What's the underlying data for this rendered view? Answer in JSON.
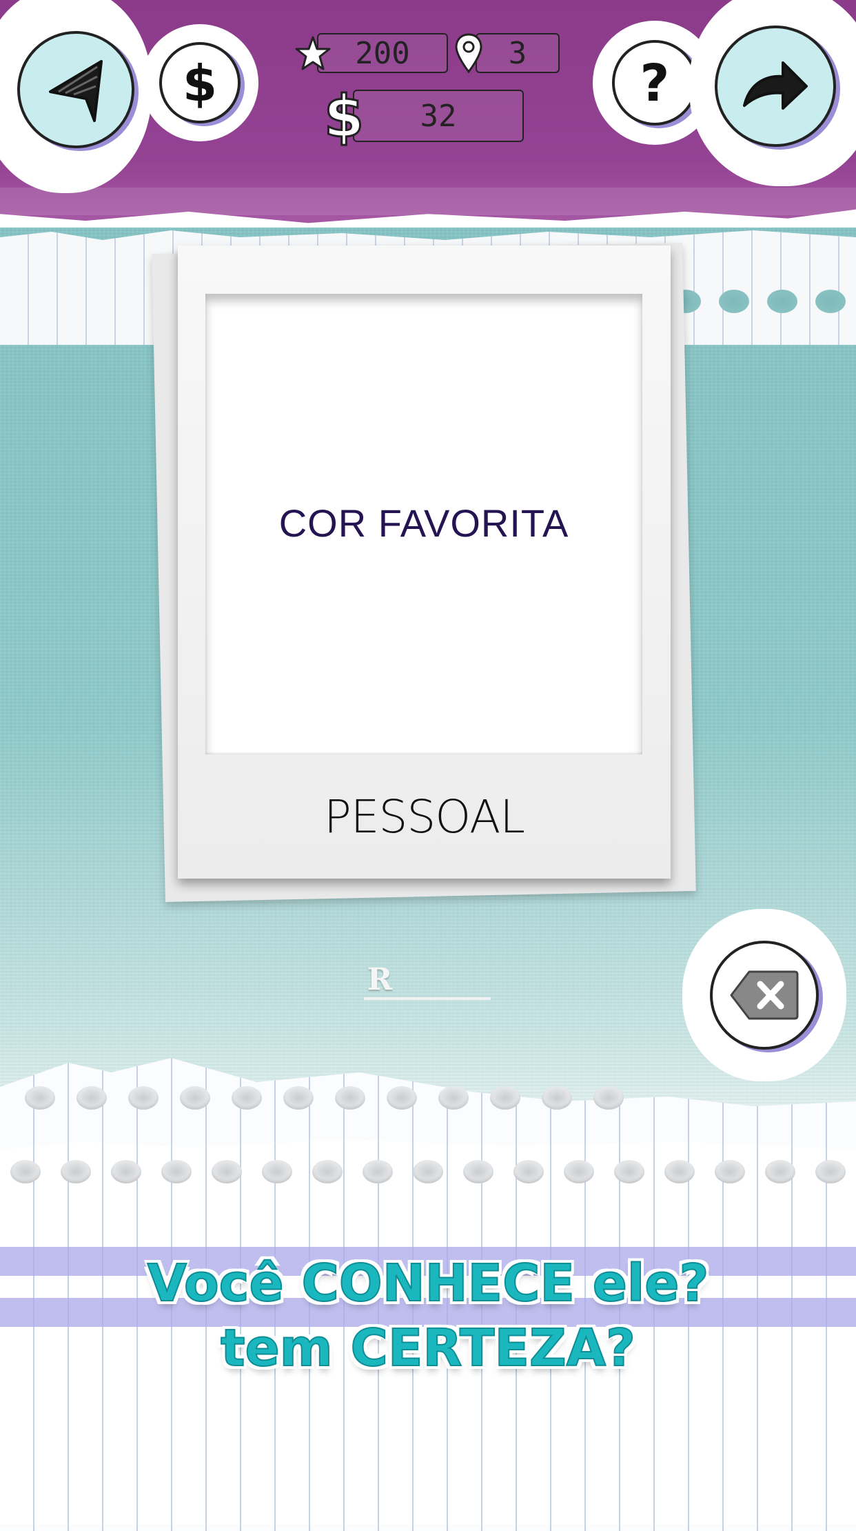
{
  "hud": {
    "stars": "200",
    "location_count": "3",
    "coins": "32"
  },
  "card": {
    "question": "COR FAVORITA",
    "category": "PESSOAL"
  },
  "answer": {
    "slots": [
      "R",
      "",
      "",
      ""
    ]
  },
  "tagline": {
    "line1": "Você CONHECE ele?",
    "line2": "tem CERTEZA?"
  },
  "colors": {
    "header_purple": "#944293",
    "teal_background": "#8fc9c9",
    "tagline_teal": "#1ab7be",
    "question_text": "#241552"
  },
  "icons": {
    "back": "back-arrow-icon",
    "shop": "dollar-icon",
    "help": "question-mark-icon",
    "skip": "forward-arrow-icon",
    "delete": "backspace-icon",
    "star": "star-icon",
    "location": "location-pin-icon",
    "currency": "dollar-sign-icon"
  }
}
